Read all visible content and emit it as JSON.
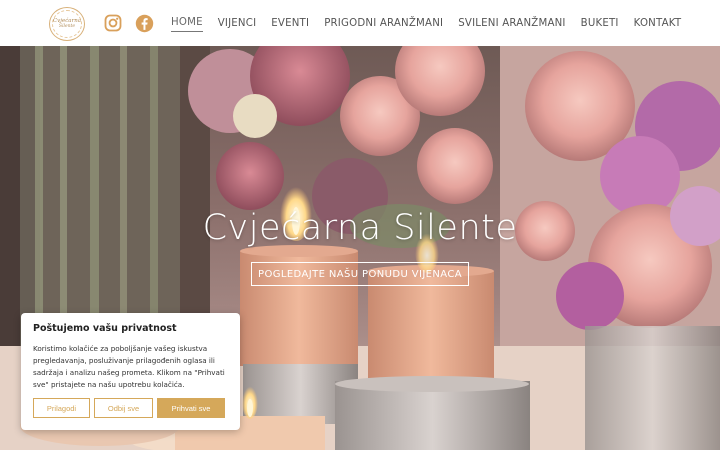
{
  "header": {
    "logo_text_line1": "Cvjećarna",
    "logo_text_line2": "Silente",
    "social": [
      {
        "icon": "instagram-icon",
        "color": "#d9a05b"
      },
      {
        "icon": "facebook-icon",
        "color": "#d9a05b"
      }
    ],
    "nav": [
      {
        "label": "HOME",
        "active": true
      },
      {
        "label": "VIJENCI",
        "active": false
      },
      {
        "label": "EVENTI",
        "active": false
      },
      {
        "label": "PRIGODNI ARANŽMANI",
        "active": false
      },
      {
        "label": "SVILENI ARANŽMANI",
        "active": false
      },
      {
        "label": "BUKETI",
        "active": false
      },
      {
        "label": "KONTAKT",
        "active": false
      }
    ]
  },
  "hero": {
    "title": "Cvjećarna Silente",
    "cta_label": "POGLEDAJTE NAŠU PONUDU VIJENACA"
  },
  "cookie": {
    "title": "Poštujemo vašu privatnost",
    "text": "Koristimo kolačiće za poboljšanje vašeg iskustva pregledavanja, posluživanje prilagođenih oglasa ili sadržaja i analizu našeg prometa. Klikom na \"Prihvati sve\" pristajete na našu upotrebu kolačića.",
    "buttons": {
      "customize": "Prilagodi",
      "reject": "Odbij sve",
      "accept": "Prihvati sve"
    },
    "accent_color": "#d5a85a"
  }
}
